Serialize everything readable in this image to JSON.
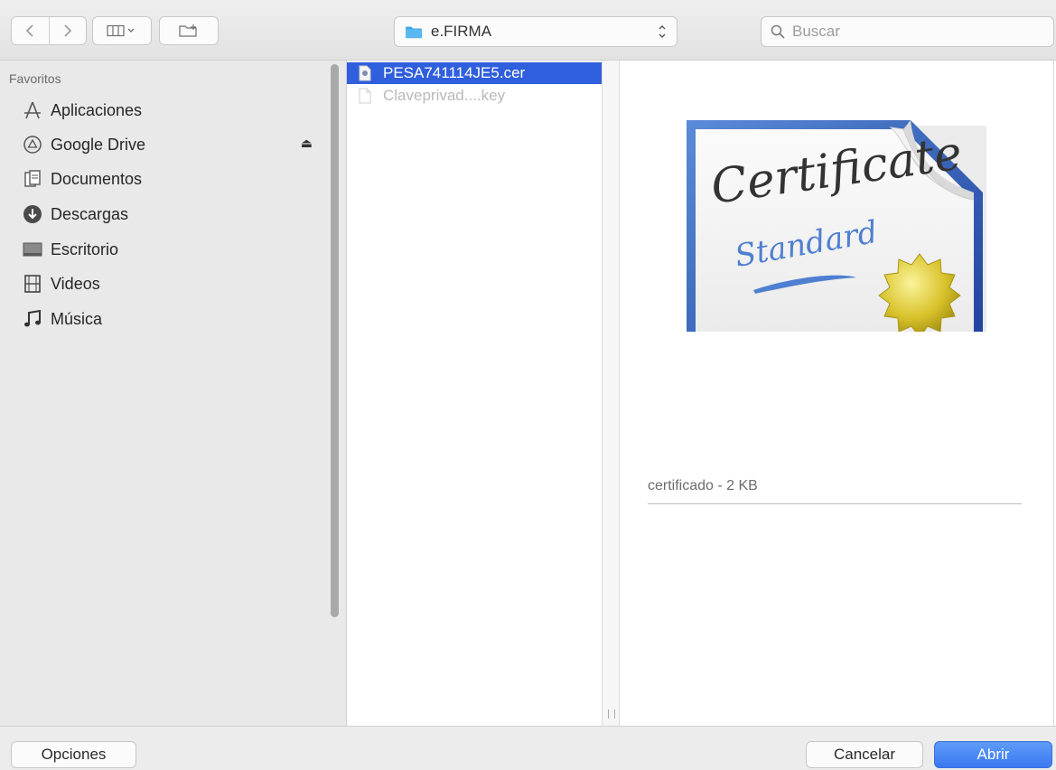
{
  "toolbar": {
    "back_icon": "chevron-left-icon",
    "forward_icon": "chevron-right-icon",
    "view_icon": "columns-view-icon",
    "new_folder_icon": "new-folder-icon",
    "location": "e.FIRMA",
    "search_placeholder": "Buscar"
  },
  "sidebar": {
    "heading": "Favoritos",
    "items": [
      {
        "label": "Aplicaciones",
        "icon": "applications-icon"
      },
      {
        "label": "Google Drive",
        "icon": "google-drive-icon"
      },
      {
        "label": "Documentos",
        "icon": "documents-icon"
      },
      {
        "label": "Descargas",
        "icon": "downloads-icon"
      },
      {
        "label": "Escritorio",
        "icon": "desktop-icon"
      },
      {
        "label": "Videos",
        "icon": "videos-icon"
      },
      {
        "label": "Música",
        "icon": "music-icon"
      }
    ]
  },
  "files": [
    {
      "name": "PESA741114JE5.cer",
      "selected": true,
      "enabled": true
    },
    {
      "name": "Claveprivad....key",
      "selected": false,
      "enabled": false
    }
  ],
  "preview": {
    "image_text_1": "Certificate",
    "image_text_2": "Standard",
    "info": "certificado - 2 KB"
  },
  "buttons": {
    "options": "Opciones",
    "cancel": "Cancelar",
    "open": "Abrir"
  },
  "colors": {
    "selection": "#2f5fdc",
    "primary": "#3a78f2"
  }
}
